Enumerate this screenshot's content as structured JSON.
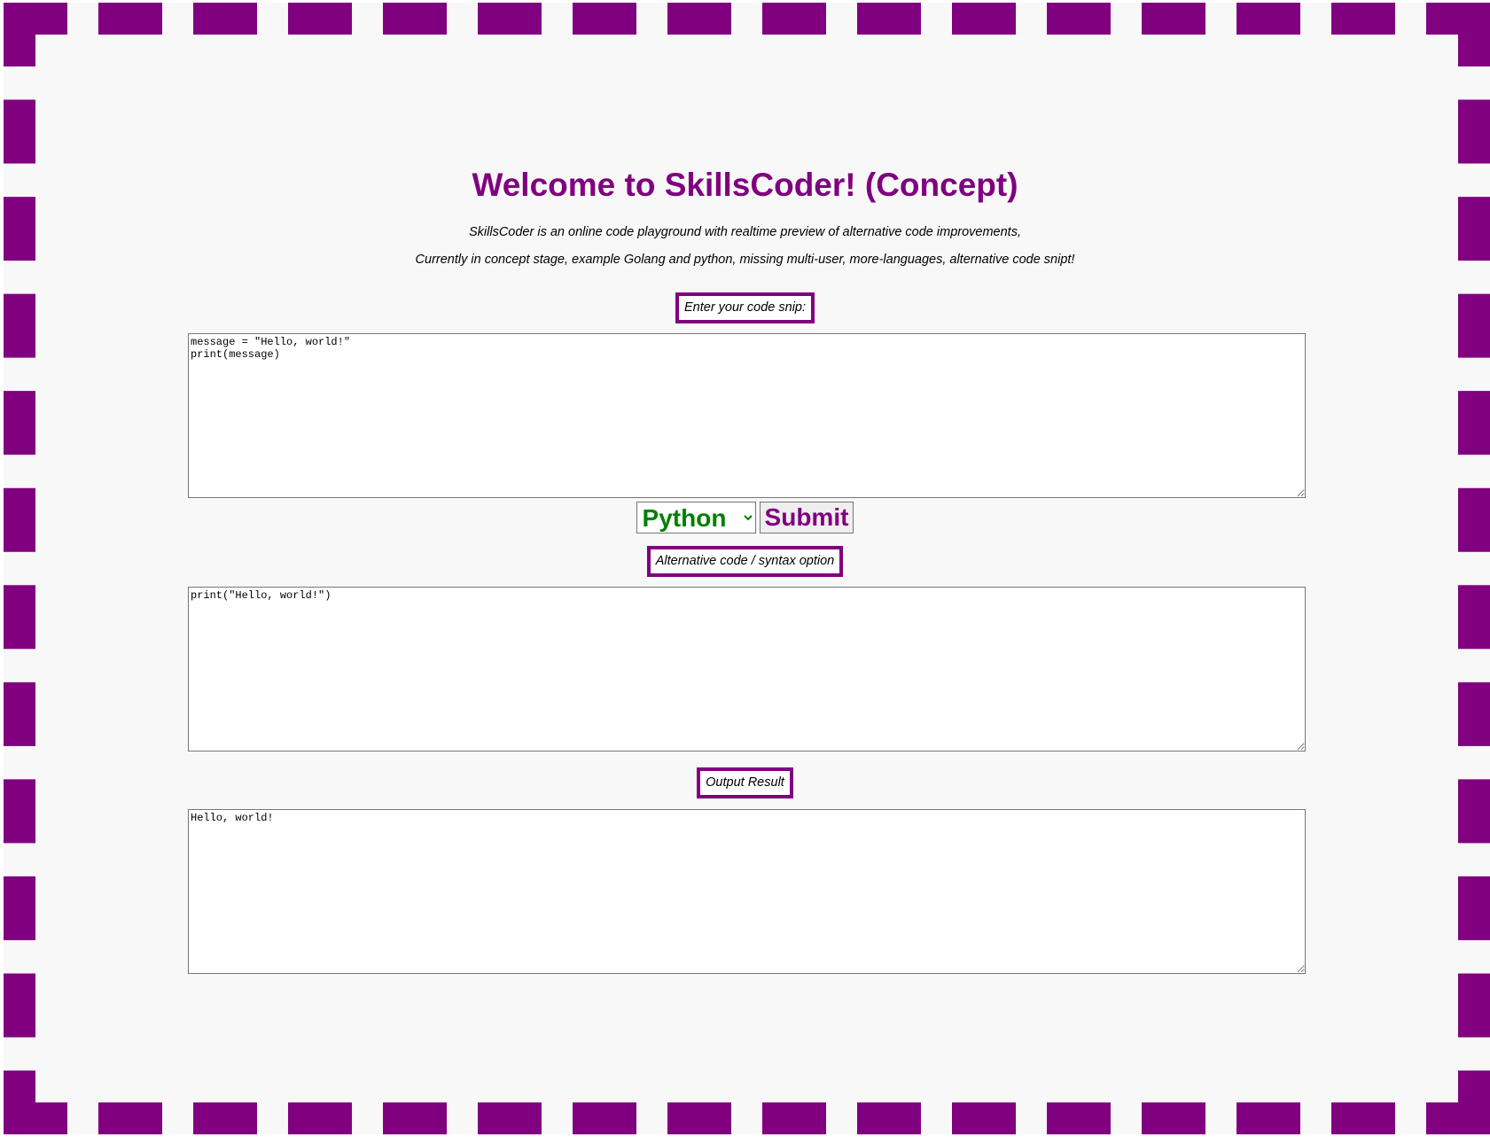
{
  "header": {
    "title": "Welcome to SkillsCoder! (Concept)",
    "description_line_1": "SkillsCoder is an online code playground with realtime preview of alternative code improvements,",
    "description_line_2": "Currently in concept stage, example Golang and python, missing multi-user, more-languages, alternative code snipt!"
  },
  "input_section": {
    "label": "Enter your code snip:",
    "code": "message = \"Hello, world!\"\nprint(message)"
  },
  "controls": {
    "language_selected": "Python",
    "submit_label": "Submit"
  },
  "alternative_section": {
    "label": "Alternative code / syntax option",
    "code": "print(\"Hello, world!\")"
  },
  "output_section": {
    "label": "Output Result",
    "output": "Hello, world!"
  },
  "colors": {
    "accent": "#800080",
    "language_text": "#008000",
    "page_background": "#f8f8f8"
  }
}
